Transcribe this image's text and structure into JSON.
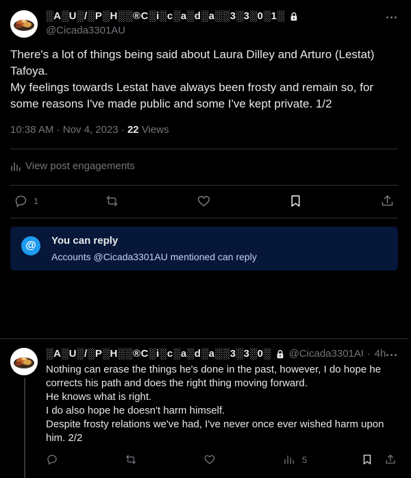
{
  "main_post": {
    "display_name": "░A░U░/░P░H░░®C░i░c░a░d░a░░3░3░0░1░",
    "handle": "@Cicada3301AU",
    "paragraphs": [
      "There's a lot of things being said about Laura Dilley and Arturo (Lestat) Tafoya.",
      "My feelings towards Lestat have always been frosty and remain so, for some reasons I've made public and some I've kept private. 1/2"
    ],
    "time": "10:38 AM",
    "date": "Nov 4, 2023",
    "views_count": "22",
    "views_label": "Views",
    "engagements_link": "View post engagements",
    "reply_count": "1"
  },
  "reply_notice": {
    "title": "You can reply",
    "subtitle": "Accounts @Cicada3301AU mentioned can reply",
    "icon_glyph": "@"
  },
  "reply_post": {
    "display_name": "░A░U░/░P░H░░®C░i░c░a░d░a░░3░3░0░",
    "handle": "@Cicada3301AU",
    "time_ago": "4h",
    "lines": [
      "Nothing can erase the things he's done in the past, however, I do hope he corrects his path and does the right thing moving forward.",
      "He knows what is right.",
      "I do also hope he doesn't harm himself.",
      "Despite frosty relations we've had, I've never once ever wished harm upon him. 2/2"
    ],
    "views_count": "5"
  },
  "colors": {
    "background": "#000000",
    "text": "#e7e9ea",
    "muted": "#71767b",
    "accent": "#1d9bf0",
    "notice_bg": "#06173a"
  }
}
